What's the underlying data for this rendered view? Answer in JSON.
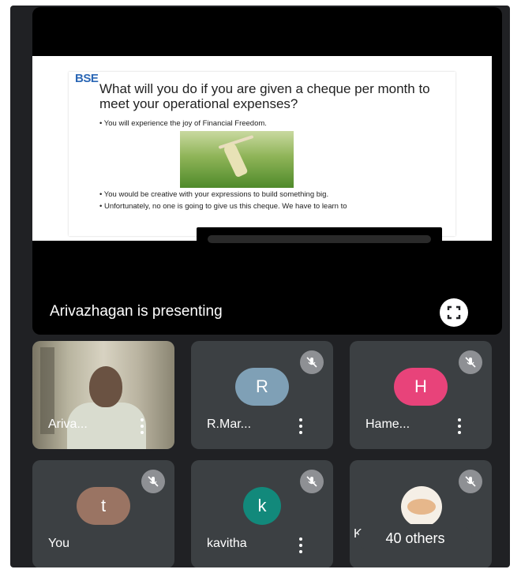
{
  "presentation": {
    "slide": {
      "logo": "BSE",
      "title": "What will you do if you are given a cheque per month to meet your operational expenses?",
      "bullets": [
        "• You will experience the joy of Financial Freedom.",
        "• You would be creative with your expressions to build something big.",
        "• Unfortunately, no one is going to give us this cheque. We have to learn to"
      ]
    },
    "presenting_label": "Arivazhagan is presenting",
    "fullscreen_icon": "fullscreen-icon"
  },
  "participants": [
    {
      "name": "Ariva...",
      "avatar_letter": "",
      "video_on": true,
      "muted": false
    },
    {
      "name": "R.Mar...",
      "avatar_letter": "R",
      "avatar_color": "#7fa0b6",
      "muted": true
    },
    {
      "name": "Hame...",
      "avatar_letter": "H",
      "avatar_color": "#e8437a",
      "muted": true
    },
    {
      "name": "You",
      "avatar_letter": "t",
      "avatar_color": "#9a7463",
      "muted": true
    },
    {
      "name": "kavitha",
      "avatar_letter": "k",
      "avatar_color": "#12897b",
      "muted": true
    },
    {
      "name": "Ka",
      "avatar_letter": "",
      "muted": true
    }
  ],
  "others": {
    "label": "40 others"
  },
  "colors": {
    "background": "#202124",
    "tile": "#3c4043",
    "mic_off_badge": "#8e9094"
  }
}
